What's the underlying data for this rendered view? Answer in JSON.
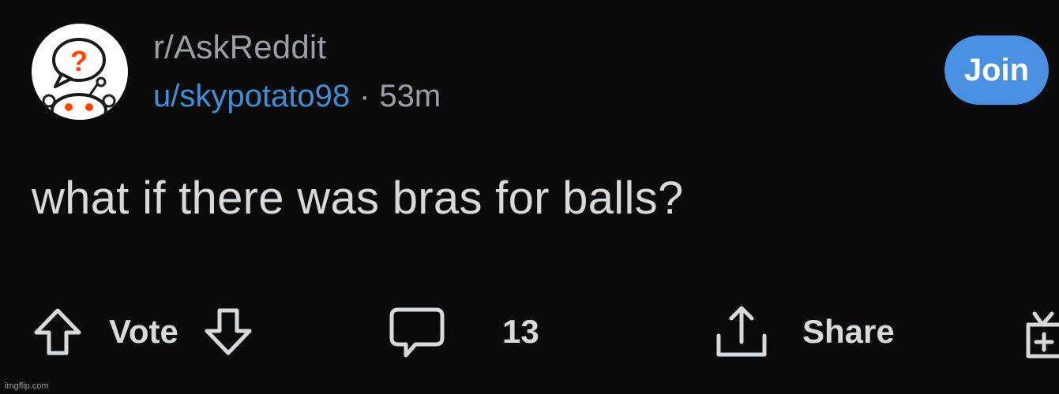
{
  "post": {
    "subreddit": "r/AskReddit",
    "author": "u/skypotato98",
    "separator": "·",
    "age": "53m",
    "join_label": "Join",
    "title": "what if there was bras for balls?"
  },
  "actions": {
    "vote_label": "Vote",
    "comment_count": "13",
    "share_label": "Share"
  },
  "icons": {
    "avatar": "subreddit-avatar-icon",
    "upvote": "upvote-arrow-icon",
    "downvote": "downvote-arrow-icon",
    "comment": "comment-bubble-icon",
    "share": "share-icon",
    "award": "award-gift-icon"
  },
  "colors": {
    "background": "#0b0b0c",
    "accent": "#4a90e2",
    "username": "#3f8fd6",
    "text": "#d7dadc",
    "muted": "#9aa0a6"
  },
  "watermark": "imgflip.com"
}
